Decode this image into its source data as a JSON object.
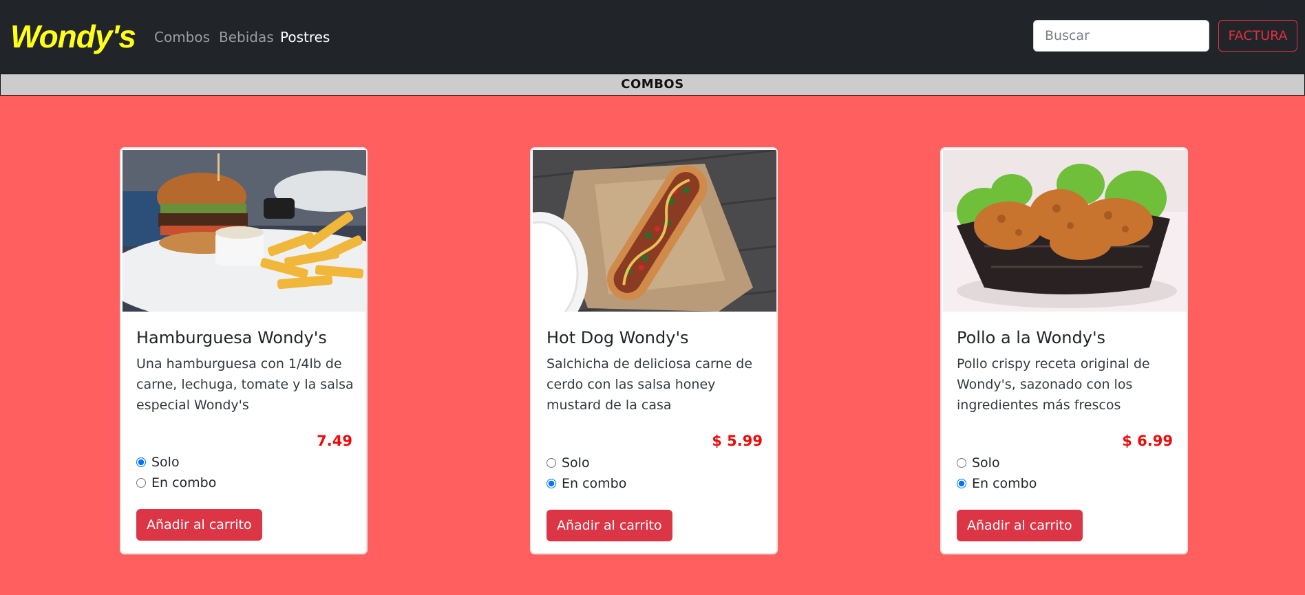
{
  "brand": "Wondy's",
  "nav": {
    "combos": "Combos",
    "bebidas": "Bebidas",
    "postres": "Postres"
  },
  "search": {
    "placeholder": "Buscar",
    "value": ""
  },
  "factura_label": "FACTURA",
  "section_title": "COMBOS",
  "products": [
    {
      "title": "Hamburguesa Wondy's",
      "description": "Una hamburguesa con 1/4lb de carne, lechuga, tomate y la salsa especial Wondy's",
      "price": "7.49",
      "option_solo": "Solo",
      "option_combo": "En combo",
      "selected": "Solo",
      "button": "Añadir al carrito",
      "image": "burger-fries-photo"
    },
    {
      "title": "Hot Dog Wondy's",
      "description": "Salchicha de deliciosa carne de cerdo con las salsa honey mustard de la casa",
      "price": "$ 5.99",
      "option_solo": "Solo",
      "option_combo": "En combo",
      "selected": "En combo",
      "button": "Añadir al carrito",
      "image": "hotdog-photo"
    },
    {
      "title": "Pollo a la Wondy's",
      "description": "Pollo crispy receta original de Wondy's, sazonado con los ingredientes más frescos",
      "price": "$ 6.99",
      "option_solo": "Solo",
      "option_combo": "En combo",
      "selected": "En combo",
      "button": "Añadir al carrito",
      "image": "fried-chicken-photo"
    }
  ],
  "colors": {
    "page_bg": "#ff5f5f",
    "navbar_bg": "#212529",
    "brand": "#ffff1a",
    "accent": "#dc3545",
    "price": "#ee0a0a"
  }
}
